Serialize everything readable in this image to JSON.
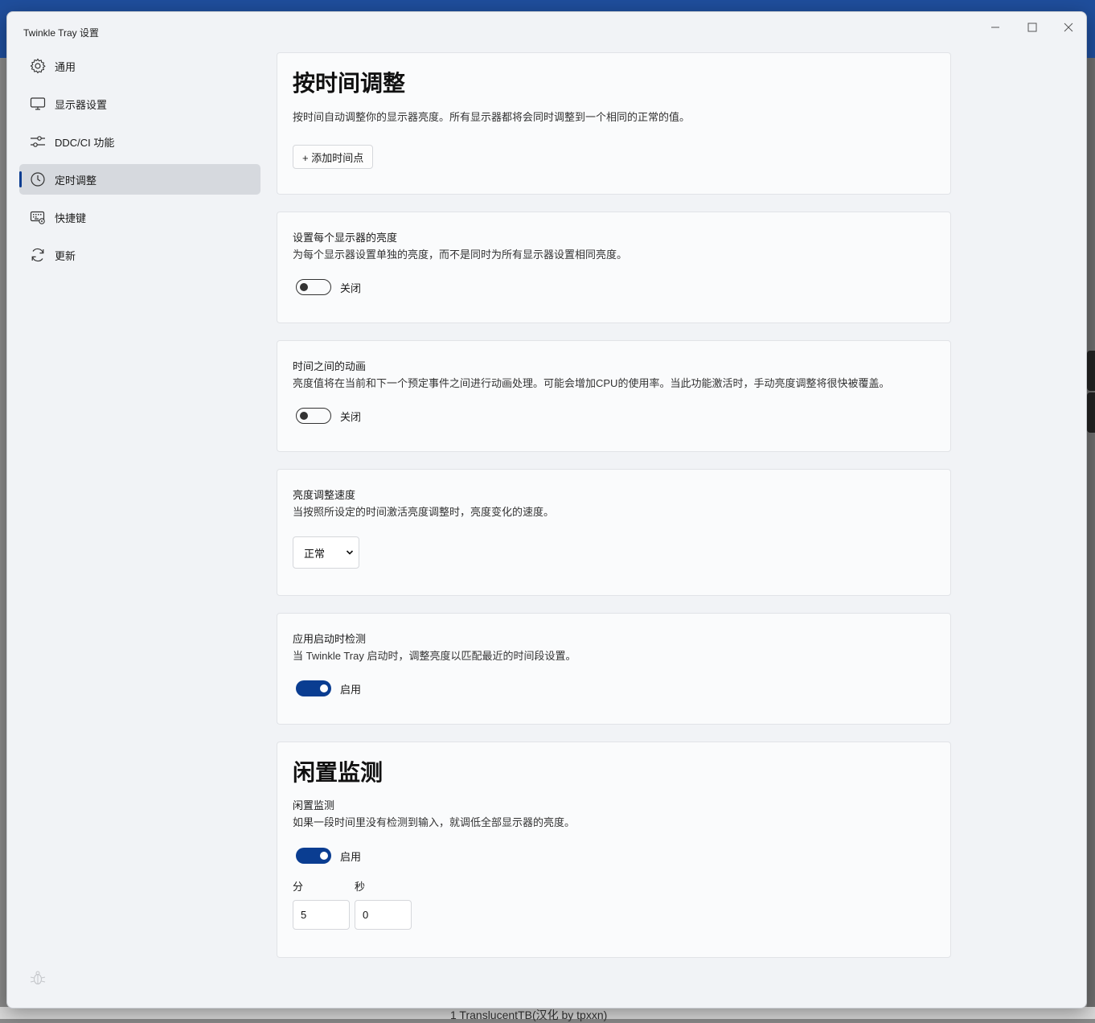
{
  "window": {
    "title": "Twinkle Tray 设置"
  },
  "taskbar_text": "1   TranslucentTB(汉化 by tpxxn)",
  "sidebar": {
    "items": [
      {
        "label": "通用",
        "icon": "gear-icon"
      },
      {
        "label": "显示器设置",
        "icon": "monitor-icon"
      },
      {
        "label": "DDC/CI 功能",
        "icon": "sliders-icon"
      },
      {
        "label": "定时调整",
        "icon": "clock-icon",
        "active": true
      },
      {
        "label": "快捷键",
        "icon": "keyboard-icon"
      },
      {
        "label": "更新",
        "icon": "refresh-icon"
      }
    ]
  },
  "schedule": {
    "heading": "按时间调整",
    "description": "按时间自动调整你的显示器亮度。所有显示器都将会同时调整到一个相同的正常的值。",
    "add_button": "+ 添加时间点"
  },
  "per_monitor": {
    "title": "设置每个显示器的亮度",
    "description": "为每个显示器设置单独的亮度，而不是同时为所有显示器设置相同亮度。",
    "toggle_label": "关闭",
    "enabled": false
  },
  "animate": {
    "title": "时间之间的动画",
    "description": "亮度值将在当前和下一个预定事件之间进行动画处理。可能会增加CPU的使用率。当此功能激活时，手动亮度调整将很快被覆盖。",
    "toggle_label": "关闭",
    "enabled": false
  },
  "speed": {
    "title": "亮度调整速度",
    "description": "当按照所设定的时间激活亮度调整时，亮度变化的速度。",
    "selected": "正常"
  },
  "startup": {
    "title": "应用启动时检测",
    "description": "当 Twinkle Tray 启动时，调整亮度以匹配最近的时间段设置。",
    "toggle_label": "启用",
    "enabled": true
  },
  "idle": {
    "heading": "闲置监测",
    "title": "闲置监测",
    "description": "如果一段时间里没有检测到输入，就调低全部显示器的亮度。",
    "toggle_label": "启用",
    "enabled": true,
    "minutes_label": "分",
    "seconds_label": "秒",
    "minutes_value": "5",
    "seconds_value": "0"
  },
  "colors": {
    "accent": "#0a3d91",
    "desktop_top": "#1f4e9c",
    "window_bg": "#f1f3f6",
    "card_bg": "#fafbfc"
  }
}
